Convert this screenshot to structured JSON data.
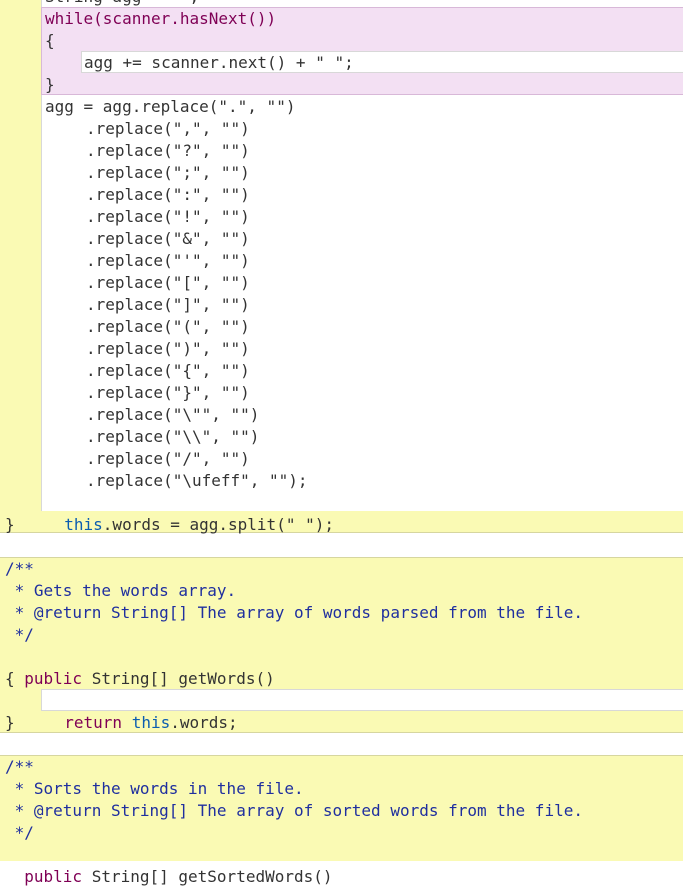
{
  "top_partial": "String agg = \"\";",
  "while_header": "while(scanner.hasNext())",
  "open_brace": "{",
  "loop_body": "agg += scanner.next() + \" \";",
  "close_brace": "}",
  "replace_first": "agg = agg.replace(\".\", \"\")",
  "replace_chain": [
    ".replace(\",\", \"\")",
    ".replace(\"?\", \"\")",
    ".replace(\";\", \"\")",
    ".replace(\":\", \"\")",
    ".replace(\"!\", \"\")",
    ".replace(\"&\", \"\")",
    ".replace(\"'\", \"\")",
    ".replace(\"[\", \"\")",
    ".replace(\"]\", \"\")",
    ".replace(\"(\", \"\")",
    ".replace(\")\", \"\")",
    ".replace(\"{\", \"\")",
    ".replace(\"}\", \"\")",
    ".replace(\"\\\"\", \"\")",
    ".replace(\"\\\\\", \"\")",
    ".replace(\"/\", \"\")",
    ".replace(\"\\ufeff\", \"\");"
  ],
  "split_line": {
    "keyword": "this",
    "rest": ".words = agg.split(\" \");"
  },
  "method_close": "}",
  "getwords_doc": [
    "/**",
    " * Gets the words array.",
    " * @return String[] The array of words parsed from the file.",
    " */"
  ],
  "getwords_sig": {
    "keyword": "public",
    "rest": " String[] getWords()"
  },
  "getwords_open": "{",
  "getwords_body": {
    "keyword1": "return",
    "keyword2": "this",
    "rest": ".words;"
  },
  "getwords_close": "}",
  "sort_doc": [
    "/**",
    " * Sorts the words in the file.",
    " * @return String[] The array of sorted words from the file.",
    " */"
  ],
  "sort_sig": {
    "keyword": "public",
    "rest": " String[] getSortedWords()"
  },
  "colors": {
    "block_yellow": "#fafab4",
    "block_pink": "#f3e0f3",
    "keyword": "#7f0055",
    "this_keyword": "#0b5db0",
    "comment": "#1f2f9f"
  }
}
